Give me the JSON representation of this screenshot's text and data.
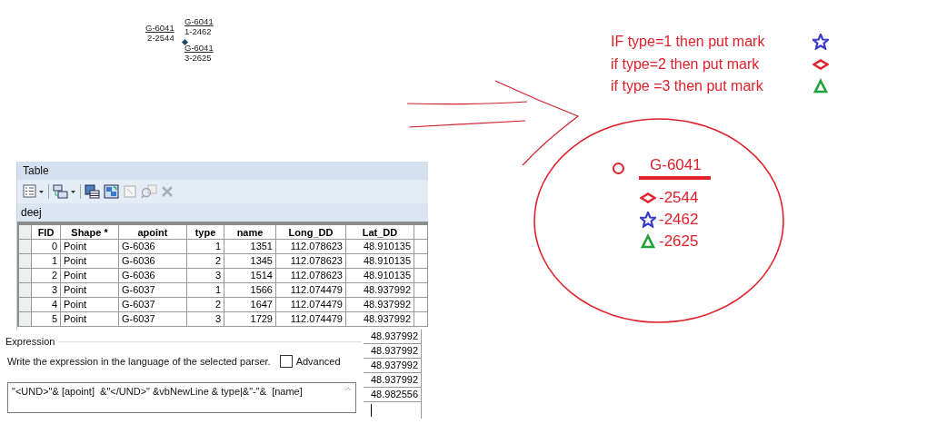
{
  "map_labels": [
    {
      "apoint": "G-6041",
      "detail": "2-2544"
    },
    {
      "apoint": "G-6041",
      "detail": "1-2462"
    },
    {
      "apoint": "G-6041",
      "detail": "3-2625"
    }
  ],
  "table": {
    "title": "Table",
    "layer": "deej",
    "columns": [
      "FID",
      "Shape *",
      "apoint",
      "type",
      "name",
      "Long_DD",
      "Lat_DD"
    ],
    "rows": [
      [
        "0",
        "Point",
        "G-6036",
        "1",
        "1351",
        "112.078623",
        "48.910135"
      ],
      [
        "1",
        "Point",
        "G-6036",
        "2",
        "1345",
        "112.078623",
        "48.910135"
      ],
      [
        "2",
        "Point",
        "G-6036",
        "3",
        "1514",
        "112.078623",
        "48.910135"
      ],
      [
        "3",
        "Point",
        "G-6037",
        "1",
        "1566",
        "112.074479",
        "48.937992"
      ],
      [
        "4",
        "Point",
        "G-6037",
        "2",
        "1647",
        "112.074479",
        "48.937992"
      ],
      [
        "5",
        "Point",
        "G-6037",
        "3",
        "1729",
        "112.074479",
        "48.937992"
      ]
    ],
    "lat_dd_below": [
      "48.937992",
      "48.937992",
      "48.937992",
      "48.937992",
      "48.982556"
    ]
  },
  "expression": {
    "group_label": "Expression",
    "hint": "Write the expression in the language of the selected parser.",
    "advanced": {
      "label": "Advanced",
      "checked": false
    },
    "value": "\"<UND>\"& [apoint]  &\"</UND>\" &vbNewLine & type|&\"-\"&  [name]"
  },
  "notes": {
    "rules": [
      {
        "text": "IF type=1 then put mark",
        "kind": "star",
        "color": "#3a3ac8"
      },
      {
        "text": "if type=2 then put mark",
        "kind": "diamond",
        "color": "#e0202a"
      },
      {
        "text": "if type =3 then put mark",
        "kind": "triangle",
        "color": "#22a03a"
      }
    ],
    "example": {
      "title": "G-6041",
      "entries": [
        {
          "kind": "diamond",
          "text": "-2544"
        },
        {
          "kind": "star",
          "text": "-2462"
        },
        {
          "kind": "triangle",
          "text": "-2625"
        }
      ]
    }
  }
}
